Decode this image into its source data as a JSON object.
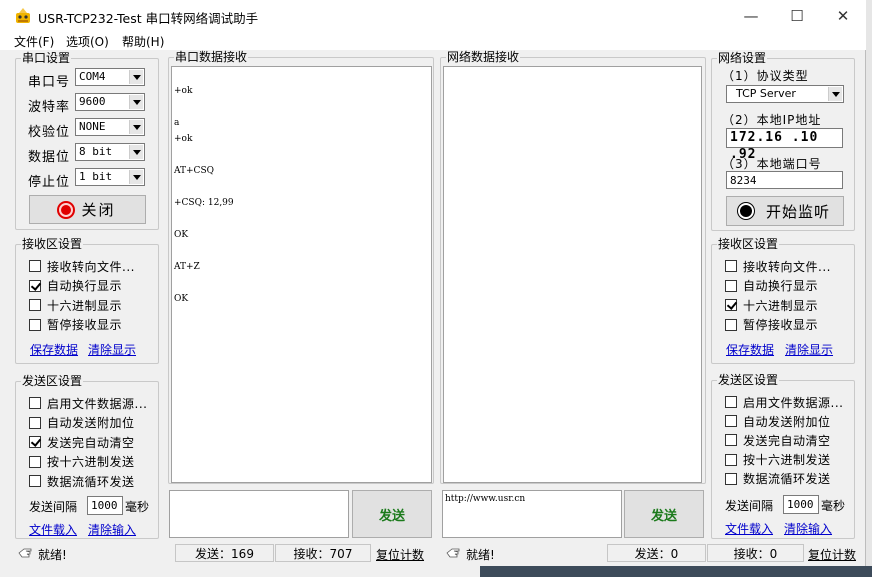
{
  "window": {
    "title": "USR-TCP232-Test 串口转网络调试助手",
    "minimize_glyph": "—",
    "maximize_glyph": "☐",
    "close_glyph": "✕"
  },
  "menu": [
    "文件(F)",
    "选项(O)",
    "帮助(H)"
  ],
  "serial_settings": {
    "title": "串口设置",
    "port_label": "串口号",
    "port_value": "COM4",
    "baud_label": "波特率",
    "baud_value": "9600",
    "parity_label": "校验位",
    "parity_value": "NONE",
    "databits_label": "数据位",
    "databits_value": "8 bit",
    "stopbits_label": "停止位",
    "stopbits_value": "1 bit",
    "close_button": "关闭"
  },
  "left_receive": {
    "title": "接收区设置",
    "options": [
      {
        "label": "接收转向文件...",
        "checked": false
      },
      {
        "label": "自动换行显示",
        "checked": true
      },
      {
        "label": "十六进制显示",
        "checked": false
      },
      {
        "label": "暂停接收显示",
        "checked": false
      }
    ],
    "save_link": "保存数据",
    "clear_link": "清除显示"
  },
  "left_send": {
    "title": "发送区设置",
    "options": [
      {
        "label": "启用文件数据源...",
        "checked": false
      },
      {
        "label": "自动发送附加位",
        "checked": false
      },
      {
        "label": "发送完自动清空",
        "checked": true
      },
      {
        "label": "按十六进制发送",
        "checked": false
      },
      {
        "label": "数据流循环发送",
        "checked": false
      }
    ],
    "interval_label": "发送间隔",
    "interval_value": "1000",
    "interval_unit": "毫秒",
    "load_link": "文件载入",
    "clear_link": "清除输入"
  },
  "serial_receive": {
    "title": "串口数据接收",
    "lines": [
      "+ok",
      "",
      "a",
      "+ok",
      "",
      "AT+CSQ",
      "",
      "+CSQ: 12,99",
      "",
      "OK",
      "",
      "AT+Z",
      "",
      "OK"
    ]
  },
  "network_receive": {
    "title": "网络数据接收"
  },
  "serial_send": {
    "input_value": "",
    "send_button": "发送"
  },
  "network_send": {
    "input_value": "http://www.usr.cn",
    "send_button": "发送"
  },
  "network_settings": {
    "title": "网络设置",
    "protocol_label": "（1）协议类型",
    "protocol_value": "TCP Server",
    "ip_label": "（2）本地IP地址",
    "ip_value": "172.16 .10 .92",
    "port_label": "（3）本地端口号",
    "port_value": "8234",
    "listen_button": "开始监听"
  },
  "right_receive": {
    "title": "接收区设置",
    "options": [
      {
        "label": "接收转向文件...",
        "checked": false
      },
      {
        "label": "自动换行显示",
        "checked": false
      },
      {
        "label": "十六进制显示",
        "checked": true
      },
      {
        "label": "暂停接收显示",
        "checked": false
      }
    ],
    "save_link": "保存数据",
    "clear_link": "清除显示"
  },
  "right_send": {
    "title": "发送区设置",
    "options": [
      {
        "label": "启用文件数据源...",
        "checked": false
      },
      {
        "label": "自动发送附加位",
        "checked": false
      },
      {
        "label": "发送完自动清空",
        "checked": false
      },
      {
        "label": "按十六进制发送",
        "checked": false
      },
      {
        "label": "数据流循环发送",
        "checked": false
      }
    ],
    "interval_label": "发送间隔",
    "interval_value": "1000",
    "interval_unit": "毫秒",
    "load_link": "文件载入",
    "clear_link": "清除输入"
  },
  "status_left": {
    "ready": "就绪!",
    "sent": "发送：169",
    "received": "接收：707",
    "reset": "复位计数"
  },
  "status_right": {
    "ready": "就绪!",
    "sent": "发送：0",
    "received": "接收：0",
    "reset": "复位计数"
  }
}
